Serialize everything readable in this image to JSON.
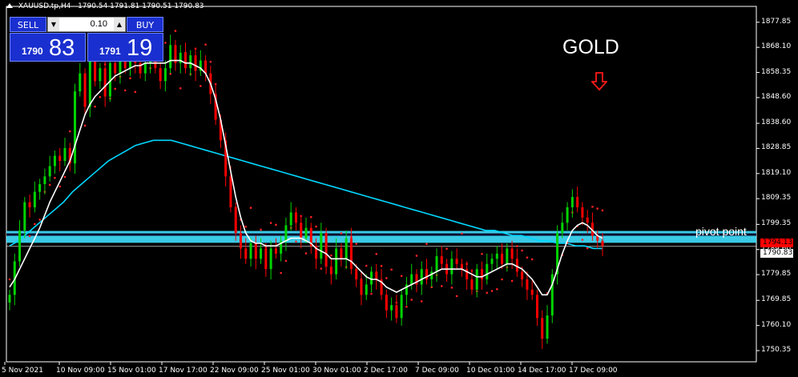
{
  "header": {
    "symbol": "XAUUSD.tp,H4",
    "ohlc": "1790.54 1791.81 1790.51 1790.83"
  },
  "trade_panel": {
    "sell_label": "SELL",
    "buy_label": "BUY",
    "lot_value": "0.10",
    "sell_price_small": "1790",
    "sell_price_big": "83",
    "buy_price_small": "1791",
    "buy_price_big": "19",
    "down_arrow": "▼",
    "up_arrow": "▲"
  },
  "annotations": {
    "title": "GOLD",
    "pivot_label": "pivot point",
    "arrow_icon": "down-arrow-icon"
  },
  "price_tags": {
    "red": "1794.13",
    "current": "1790.83"
  },
  "colors": {
    "background": "#000000",
    "bull_candle": "#00d400",
    "bear_candle": "#ff0000",
    "sar_dots": "#ff2222",
    "ma_fast": "#ffffff",
    "ma_slow": "#00d8ff",
    "pivot_zone": "#40e0ff",
    "panel_blue": "#1a2fcf"
  },
  "chart_data": {
    "type": "line",
    "title": "",
    "ylim": [
      1746,
      1884
    ],
    "y_ticks": [
      "1877.85",
      "1868.10",
      "1858.35",
      "1848.60",
      "1838.60",
      "1828.85",
      "1819.10",
      "1809.35",
      "1799.35",
      "1789.60",
      "1779.85",
      "1769.85",
      "1760.10",
      "1750.35"
    ],
    "x_ticks": [
      "5 Nov 2021",
      "10 Nov 09:00",
      "15 Nov 01:00",
      "17 Nov 17:00",
      "22 Nov 09:00",
      "25 Nov 01:00",
      "30 Nov 01:00",
      "2 Dec 17:00",
      "7 Dec 09:00",
      "10 Dec 01:00",
      "14 Dec 17:00",
      "17 Dec 09:00"
    ],
    "pivot_zone": [
      1792.2,
      1796.8
    ],
    "series": [
      {
        "values": [
          1772,
          1785,
          1797,
          1808,
          1806,
          1812,
          1815,
          1818,
          1822,
          1826,
          1824,
          1829,
          1823,
          1851,
          1858,
          1845,
          1863,
          1855,
          1860,
          1849,
          1862,
          1858,
          1864,
          1860,
          1866,
          1862,
          1858,
          1862,
          1866,
          1860,
          1855,
          1860,
          1869,
          1862,
          1866,
          1860,
          1865,
          1859,
          1863,
          1858,
          1850,
          1840,
          1832,
          1818,
          1806,
          1796,
          1790,
          1786,
          1792,
          1786,
          1790,
          1782,
          1790,
          1788,
          1793,
          1799,
          1804,
          1800,
          1794,
          1798,
          1791,
          1786,
          1796,
          1783,
          1780,
          1790,
          1786,
          1794,
          1782,
          1778,
          1772,
          1776,
          1781,
          1778,
          1772,
          1766,
          1768,
          1763,
          1772,
          1776,
          1780,
          1776,
          1782,
          1778,
          1781,
          1787,
          1784,
          1780,
          1786,
          1784,
          1782,
          1778,
          1774,
          1782,
          1778,
          1784,
          1786,
          1788,
          1784,
          1790,
          1786,
          1781,
          1778,
          1774,
          1772,
          1763,
          1755,
          1764,
          1780,
          1796,
          1800,
          1806,
          1810,
          1806,
          1802,
          1800,
          1795,
          1793,
          1791
        ]
      },
      {
        "values": [
          1775,
          1778,
          1782,
          1786,
          1790,
          1794,
          1798,
          1803,
          1808,
          1812,
          1816,
          1820,
          1824,
          1830,
          1836,
          1842,
          1846,
          1849,
          1851,
          1853,
          1855,
          1857,
          1858,
          1859,
          1860,
          1861,
          1861,
          1862,
          1862,
          1862,
          1862,
          1862,
          1863,
          1863,
          1863,
          1862,
          1862,
          1861,
          1860,
          1858,
          1854,
          1848,
          1840,
          1830,
          1820,
          1810,
          1802,
          1796,
          1793,
          1792,
          1792,
          1791,
          1791,
          1791,
          1792,
          1793,
          1794,
          1794,
          1794,
          1793,
          1792,
          1790,
          1789,
          1788,
          1786,
          1786,
          1786,
          1786,
          1785,
          1783,
          1781,
          1779,
          1778,
          1778,
          1777,
          1775,
          1774,
          1773,
          1774,
          1775,
          1776,
          1777,
          1778,
          1779,
          1780,
          1781,
          1782,
          1782,
          1782,
          1782,
          1782,
          1781,
          1780,
          1779,
          1779,
          1780,
          1781,
          1782,
          1783,
          1784,
          1784,
          1783,
          1782,
          1780,
          1778,
          1775,
          1772,
          1772,
          1776,
          1782,
          1788,
          1793,
          1797,
          1799,
          1800,
          1799,
          1797,
          1795,
          1794
        ]
      },
      {
        "values": [
          1791,
          1793,
          1796,
          1799,
          1802,
          1805,
          1808,
          1812,
          1815,
          1818,
          1821,
          1824,
          1826,
          1828,
          1830,
          1831,
          1832,
          1832,
          1832,
          1831,
          1830,
          1829,
          1828,
          1827,
          1826,
          1825,
          1824,
          1823,
          1822,
          1821,
          1820,
          1819,
          1818,
          1817,
          1816,
          1815,
          1814,
          1813,
          1812,
          1811,
          1810,
          1809,
          1808,
          1807,
          1806,
          1805,
          1804,
          1803,
          1802,
          1801,
          1800,
          1799,
          1798,
          1797,
          1797,
          1796,
          1795,
          1795,
          1794,
          1793,
          1793,
          1792,
          1792,
          1791,
          1791,
          1790,
          1790
        ]
      }
    ]
  }
}
